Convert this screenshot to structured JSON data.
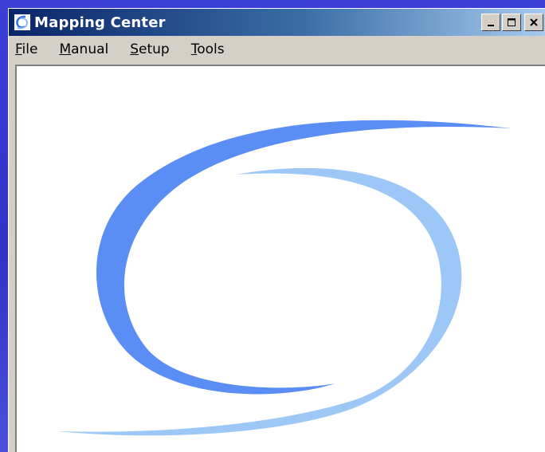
{
  "window": {
    "title": "Mapping Center",
    "icon": "swirl-logo-icon",
    "controls": [
      "minimize-icon",
      "maximize-icon",
      "close-icon"
    ]
  },
  "menu": {
    "items": [
      {
        "mnemonic": "F",
        "rest": "ile"
      },
      {
        "mnemonic": "M",
        "rest": "anual"
      },
      {
        "mnemonic": "S",
        "rest": "etup"
      },
      {
        "mnemonic": "T",
        "rest": "ools"
      }
    ]
  },
  "colors": {
    "desktop": "#2e33c8",
    "titlebar_start": "#0a246a",
    "titlebar_end": "#a6caf0",
    "swirl_dark": "#5b8ef5",
    "swirl_light": "#9cc7f7"
  }
}
